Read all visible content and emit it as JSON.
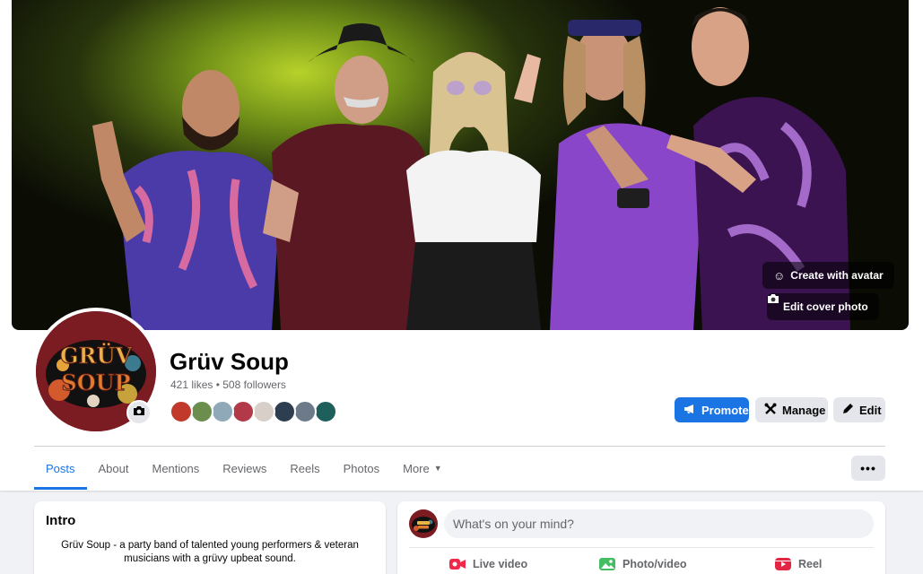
{
  "cover": {
    "create_avatar_label": "Create with avatar",
    "edit_cover_label": "Edit cover photo"
  },
  "profile": {
    "name": "Grüv Soup",
    "stats": "421 likes • 508 followers",
    "logo_text_top": "GRÜV",
    "logo_text_bottom": "SOUP"
  },
  "actions": {
    "promote": "Promote",
    "manage": "Manage",
    "edit": "Edit"
  },
  "tabs": [
    {
      "label": "Posts"
    },
    {
      "label": "About"
    },
    {
      "label": "Mentions"
    },
    {
      "label": "Reviews"
    },
    {
      "label": "Reels"
    },
    {
      "label": "Photos"
    },
    {
      "label": "More"
    }
  ],
  "more_dots": "•••",
  "intro": {
    "title": "Intro",
    "text": "Grüv Soup - a party band of talented young performers & veteran musicians with a grüvy upbeat sound."
  },
  "composer": {
    "placeholder": "What's on your mind?",
    "live_video": "Live video",
    "photo_video": "Photo/video",
    "reel": "Reel"
  },
  "colors": {
    "accent": "#1b74e4",
    "secondary_button": "#e4e6eb",
    "muted_text": "#65676b",
    "logo_background": "#7b1b22",
    "live_icon": "#f02849",
    "photo_icon": "#45bd62",
    "reel_icon": "#e42645"
  },
  "avatar_colors": [
    "#c0392b",
    "#6b8e4e",
    "#8fa9b8",
    "#b23a48",
    "#d8d0c8",
    "#2c3e50",
    "#6c7a89",
    "#1f5f5b"
  ]
}
